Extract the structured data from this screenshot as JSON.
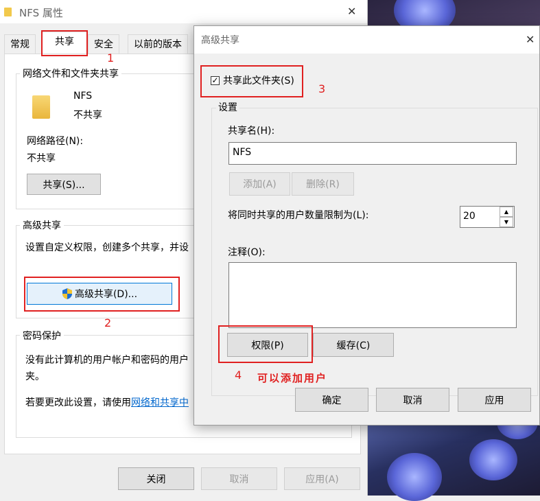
{
  "props_window": {
    "title": "NFS 属性",
    "close_glyph": "✕",
    "tabs": [
      "常规",
      "共享",
      "安全",
      "以前的版本"
    ],
    "network_share": {
      "group_title": "网络文件和文件夹共享",
      "folder_name": "NFS",
      "folder_status": "不共享",
      "network_path_label": "网络路径(N):",
      "network_path_value": "不共享",
      "share_button": "共享(S)..."
    },
    "advanced_share": {
      "group_title": "高级共享",
      "description": "设置自定义权限，创建多个共享，并设",
      "button": "高级共享(D)..."
    },
    "password": {
      "group_title": "密码保护",
      "line1": "没有此计算机的用户帐户和密码的用户",
      "line2": "夹。",
      "line3_prefix": "若要更改此设置，请使用",
      "line3_link": "网络和共享中"
    },
    "buttons": {
      "close": "关闭",
      "cancel": "取消",
      "apply": "应用(A)"
    }
  },
  "advanced_dialog": {
    "title": "高级共享",
    "close_glyph": "✕",
    "share_checkbox_label": "共享此文件夹(S)",
    "share_checked": true,
    "settings_group": "设置",
    "share_name_label": "共享名(H):",
    "share_name_value": "NFS",
    "add_button": "添加(A)",
    "remove_button": "删除(R)",
    "user_limit_label": "将同时共享的用户数量限制为(L):",
    "user_limit_value": "20",
    "comment_label": "注释(O):",
    "comment_value": "",
    "permissions_button": "权限(P)",
    "caching_button": "缓存(C)",
    "ok_button": "确定",
    "cancel_button": "取消",
    "apply_button": "应用"
  },
  "annotations": {
    "step1": "1",
    "step2": "2",
    "step3": "3",
    "step4": "4",
    "step4_note": "可以添加用户",
    "color": "#e02020"
  }
}
